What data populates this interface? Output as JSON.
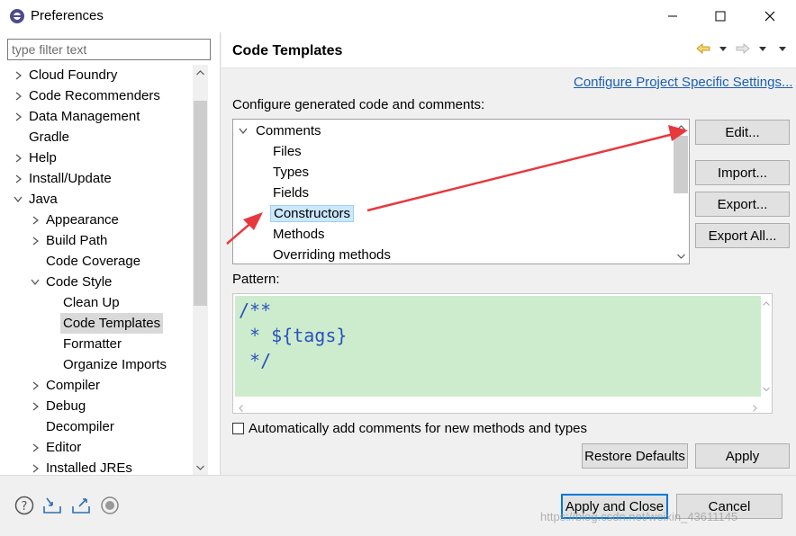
{
  "window": {
    "title": "Preferences"
  },
  "left": {
    "filter_placeholder": "type filter text",
    "tree": [
      {
        "label": "Cloud Foundry",
        "depth": 0,
        "chevron": "right"
      },
      {
        "label": "Code Recommenders",
        "depth": 0,
        "chevron": "right"
      },
      {
        "label": "Data Management",
        "depth": 0,
        "chevron": "right"
      },
      {
        "label": "Gradle",
        "depth": 0,
        "chevron": "none"
      },
      {
        "label": "Help",
        "depth": 0,
        "chevron": "right"
      },
      {
        "label": "Install/Update",
        "depth": 0,
        "chevron": "right"
      },
      {
        "label": "Java",
        "depth": 0,
        "chevron": "down"
      },
      {
        "label": "Appearance",
        "depth": 1,
        "chevron": "right"
      },
      {
        "label": "Build Path",
        "depth": 1,
        "chevron": "right"
      },
      {
        "label": "Code Coverage",
        "depth": 1,
        "chevron": "none"
      },
      {
        "label": "Code Style",
        "depth": 1,
        "chevron": "down"
      },
      {
        "label": "Clean Up",
        "depth": 2,
        "chevron": "none"
      },
      {
        "label": "Code Templates",
        "depth": 2,
        "chevron": "none",
        "selected": true
      },
      {
        "label": "Formatter",
        "depth": 2,
        "chevron": "none"
      },
      {
        "label": "Organize Imports",
        "depth": 2,
        "chevron": "none"
      },
      {
        "label": "Compiler",
        "depth": 1,
        "chevron": "right"
      },
      {
        "label": "Debug",
        "depth": 1,
        "chevron": "right"
      },
      {
        "label": "Decompiler",
        "depth": 1,
        "chevron": "none"
      },
      {
        "label": "Editor",
        "depth": 1,
        "chevron": "right"
      },
      {
        "label": "Installed JREs",
        "depth": 1,
        "chevron": "right"
      }
    ]
  },
  "right": {
    "title": "Code Templates",
    "configure_link": "Configure Project Specific Settings...",
    "section_label": "Configure generated code and comments:",
    "templates": [
      {
        "label": "Comments",
        "depth": 0,
        "chevron": "down"
      },
      {
        "label": "Files",
        "depth": 1
      },
      {
        "label": "Types",
        "depth": 1
      },
      {
        "label": "Fields",
        "depth": 1
      },
      {
        "label": "Constructors",
        "depth": 1,
        "selected": true
      },
      {
        "label": "Methods",
        "depth": 1
      },
      {
        "label": "Overriding methods",
        "depth": 1
      }
    ],
    "buttons": {
      "edit": "Edit...",
      "import": "Import...",
      "export": "Export...",
      "export_all": "Export All...",
      "restore_defaults": "Restore Defaults",
      "apply": "Apply"
    },
    "pattern_label": "Pattern:",
    "pattern_text": "/**\n * ${tags}\n */",
    "auto_comment_label": "Automatically add comments for new methods and types",
    "auto_comment_checked": false
  },
  "footer": {
    "apply_close": "Apply and Close",
    "cancel": "Cancel",
    "watermark": "https://blog.csdn.net/weixin_43611145"
  },
  "colors": {
    "selection_left": "#d9d9d9",
    "selection_right": "#cce8ff",
    "pattern_bg": "#cdeccd",
    "pattern_fg": "#2a52be",
    "link": "#1a5fb4",
    "annotation_arrow": "#e8383d"
  }
}
